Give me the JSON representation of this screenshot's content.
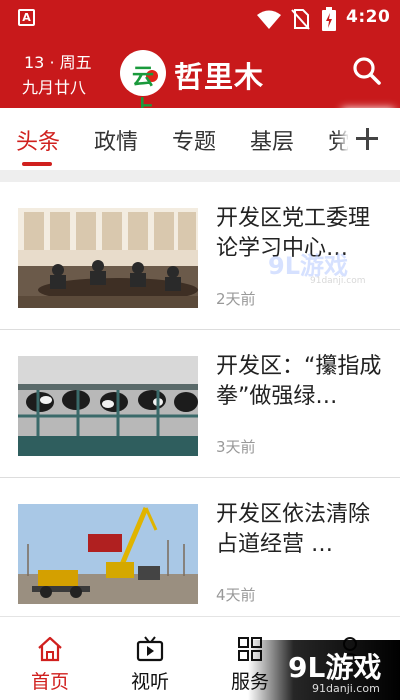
{
  "status_bar": {
    "app_badge": "A",
    "time": "4:20",
    "icons": [
      "app-notification-icon",
      "wifi-icon",
      "no-sim-icon",
      "battery-charging-icon"
    ]
  },
  "header": {
    "date_line1": "13 · 周五",
    "date_line2": "九月廿八",
    "logo_glyph": "云上",
    "logo_text": "哲里木",
    "search_icon": "search-icon",
    "background": "#c8191b"
  },
  "tabs": {
    "items": [
      "头条",
      "政情",
      "专题",
      "基层",
      "党"
    ],
    "active_index": 0,
    "add_icon": "plus-icon",
    "accent": "#d0201e"
  },
  "news": [
    {
      "title": "开发区党工委理论学习中心…",
      "time": "2天前",
      "thumb": "meeting-room-photo"
    },
    {
      "title": "开发区：“攥指成拳”做强绿…",
      "time": "3天前",
      "thumb": "dairy-farm-photo"
    },
    {
      "title": "开发区依法清除占道经营 …",
      "time": "4天前",
      "thumb": "road-clearing-photo"
    }
  ],
  "bottom_nav": {
    "items": [
      {
        "label": "首页",
        "icon": "home-icon"
      },
      {
        "label": "视听",
        "icon": "video-icon"
      },
      {
        "label": "服务",
        "icon": "grid-icon"
      },
      {
        "label": "",
        "icon": "user-icon"
      }
    ],
    "active_index": 0
  },
  "watermarks": {
    "mid_text": "9L游戏",
    "mid_sub": "91danji.com",
    "corner_text": "9L游戏",
    "corner_sub": "91danji.com"
  }
}
